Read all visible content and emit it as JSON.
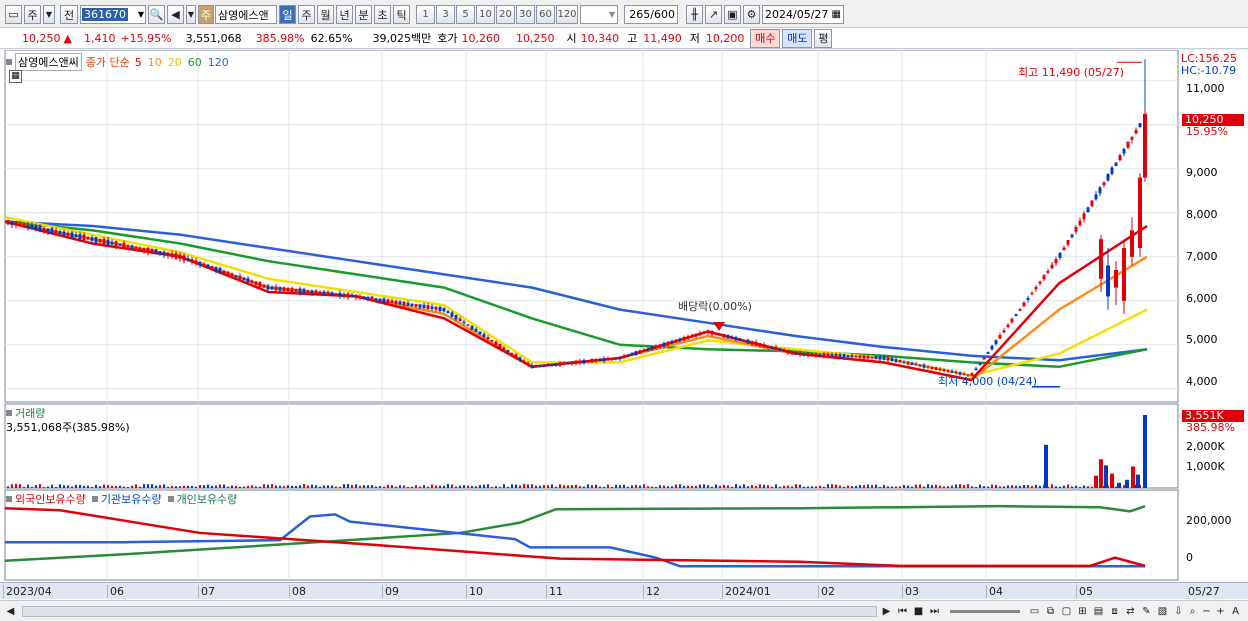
{
  "toolbar": {
    "freq_label": "주",
    "prev_label": "전",
    "code": "361670",
    "type_badge": "주",
    "name": "삼영에스앤",
    "period_tabs": [
      "일",
      "주",
      "월",
      "년",
      "분",
      "초",
      "틱"
    ],
    "interval_buttons": [
      "1",
      "3",
      "5",
      "10",
      "20",
      "30",
      "60",
      "120"
    ],
    "count": "265",
    "count_total": "/600",
    "date": "2024/05/27"
  },
  "quote": {
    "price": "10,250",
    "up_arrow": "▲",
    "change": "1,410",
    "change_pct": "+15.95%",
    "volume": "3,551,068",
    "volume_pct": "385.98%",
    "rotation": "62.65%",
    "amount": "39,025백만",
    "bid_label": "호가",
    "bid": "10,260",
    "ask": "10,250",
    "open_label": "시",
    "open": "10,340",
    "high_label": "고",
    "high": "11,490",
    "low_label": "저",
    "low": "10,200",
    "buy_label": "매수",
    "sell_label": "매도",
    "eval_label": "평"
  },
  "price_panel": {
    "stock_tag": "삼영에스앤씨",
    "ma_label": "종가 단순",
    "ma_periods": [
      "5",
      "10",
      "20",
      "60",
      "120"
    ],
    "lc": "LC:156.25",
    "hc": "HC:-10.79",
    "current_price": "10,250",
    "current_pct": "15.95%",
    "high_note": "최고 11,490 (05/27)",
    "low_note": "최저 4,000 (04/24)",
    "dividend_note": "배당락(0.00%)",
    "y_ticks": [
      "11,000",
      "10,000",
      "9,000",
      "8,000",
      "7,000",
      "6,000",
      "5,000",
      "4,000"
    ]
  },
  "volume_panel": {
    "title": "거래량",
    "value": "3,551,068주(385.98%)",
    "tag": "3,551K",
    "tag_pct": "385.98%",
    "y_ticks": [
      "2,000K",
      "1,000K"
    ]
  },
  "holdings_panel": {
    "legend": [
      "외국인보유수량",
      "기관보유수량",
      "개인보유수량"
    ],
    "y_ticks": [
      "200,000",
      "0"
    ]
  },
  "x_axis": [
    "2023/04",
    "06",
    "07",
    "08",
    "09",
    "10",
    "11",
    "12",
    "2024/01",
    "02",
    "03",
    "04",
    "05"
  ],
  "x_end": "05/27",
  "colors": {
    "up": "#e0000a",
    "down": "#0038c8",
    "ma5": "#e0000a",
    "ma10": "#ff8c1a",
    "ma20": "#f4e000",
    "ma60": "#1a9a2a",
    "ma120": "#2a5fd8"
  },
  "chart_data": {
    "type": "candlestick",
    "x": [
      "2023/04",
      "06",
      "07",
      "08",
      "09",
      "10",
      "11",
      "12",
      "2024/01",
      "02",
      "03",
      "04",
      "05",
      "05/27"
    ],
    "close_approx": [
      7800,
      7400,
      7000,
      6300,
      6100,
      5800,
      4500,
      4700,
      5300,
      4800,
      4700,
      4300,
      7000,
      10250
    ],
    "ylim": [
      3700,
      11700
    ],
    "high": 11490,
    "low": 4000,
    "series": [
      {
        "name": "5",
        "values": [
          7800,
          7300,
          7000,
          6200,
          6100,
          5600,
          4500,
          4700,
          5300,
          4800,
          4600,
          4200,
          6400,
          7700
        ]
      },
      {
        "name": "10",
        "values": [
          7800,
          7400,
          7000,
          6300,
          6100,
          5700,
          4500,
          4700,
          5200,
          4800,
          4600,
          4200,
          5800,
          7000
        ]
      },
      {
        "name": "20",
        "values": [
          7900,
          7500,
          7100,
          6500,
          6200,
          5900,
          4600,
          4600,
          5100,
          4900,
          4700,
          4300,
          4800,
          5800
        ]
      },
      {
        "name": "60",
        "values": [
          7800,
          7600,
          7300,
          6900,
          6600,
          6300,
          5600,
          5000,
          4900,
          4850,
          4750,
          4600,
          4500,
          4900
        ]
      },
      {
        "name": "120",
        "values": [
          7800,
          7700,
          7500,
          7200,
          6900,
          6600,
          6300,
          5800,
          5500,
          5200,
          4950,
          4750,
          4650,
          4900
        ]
      }
    ]
  }
}
